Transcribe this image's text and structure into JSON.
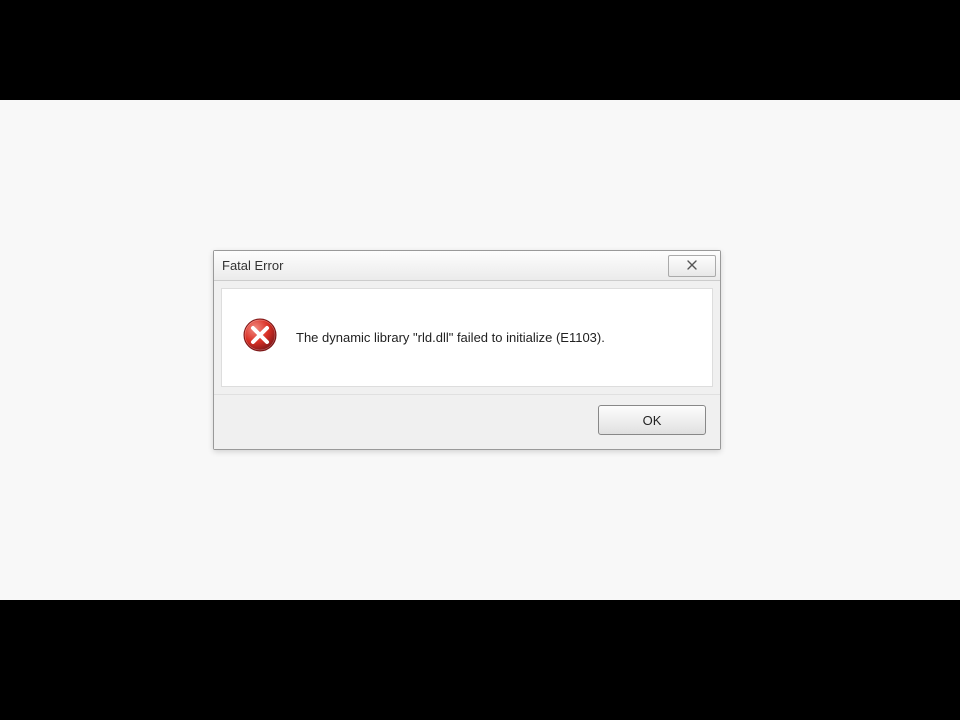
{
  "dialog": {
    "title": "Fatal Error",
    "message": "The dynamic library \"rld.dll\" failed to initialize (E1103).",
    "ok_label": "OK",
    "icon": "error-icon",
    "close_icon": "close-icon",
    "colors": {
      "error_red": "#c0392b",
      "error_red_dark": "#8b1a1a"
    }
  }
}
